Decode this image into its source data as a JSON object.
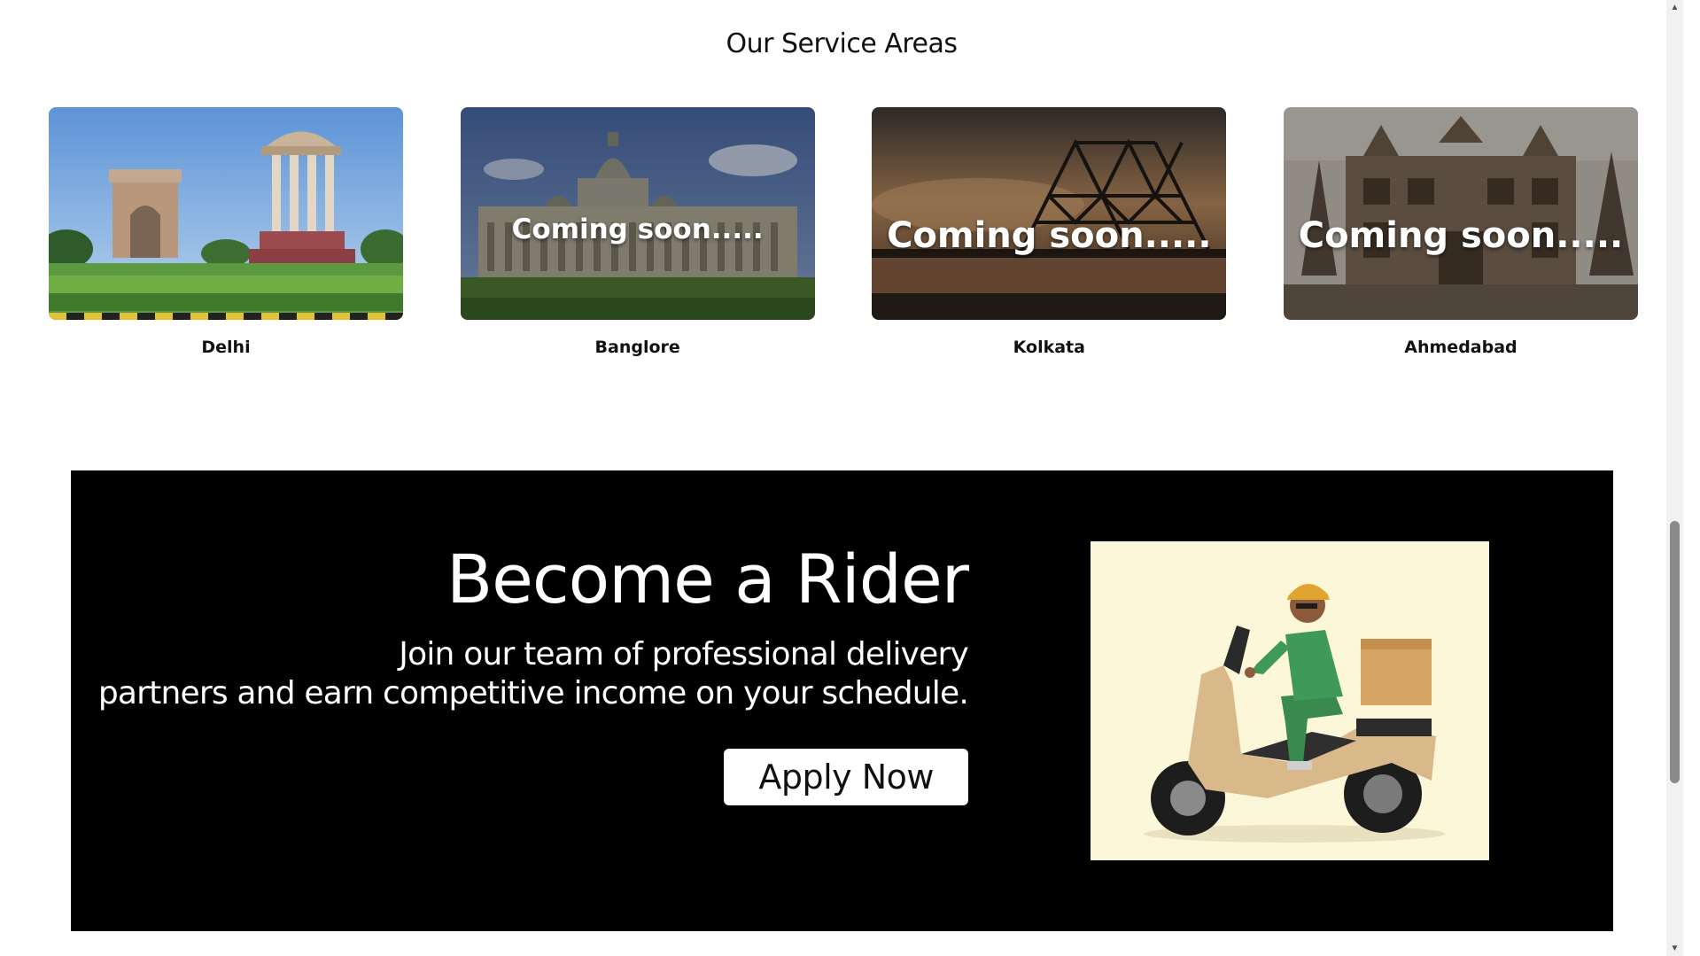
{
  "service_areas": {
    "title": "Our Service Areas",
    "cities": [
      {
        "name": "Delhi",
        "status": ""
      },
      {
        "name": "Banglore",
        "status": "Coming soon....."
      },
      {
        "name": "Kolkata",
        "status": "Coming soon....."
      },
      {
        "name": "Ahmedabad",
        "status": "Coming soon....."
      }
    ]
  },
  "rider": {
    "title": "Become a Rider",
    "description_line1": "Join our team of professional delivery",
    "description_line2": "partners and earn competitive income on your schedule.",
    "apply_label": "Apply Now"
  },
  "icons": {
    "scroll_up": "triangle-up-icon",
    "scroll_down": "triangle-down-icon"
  }
}
